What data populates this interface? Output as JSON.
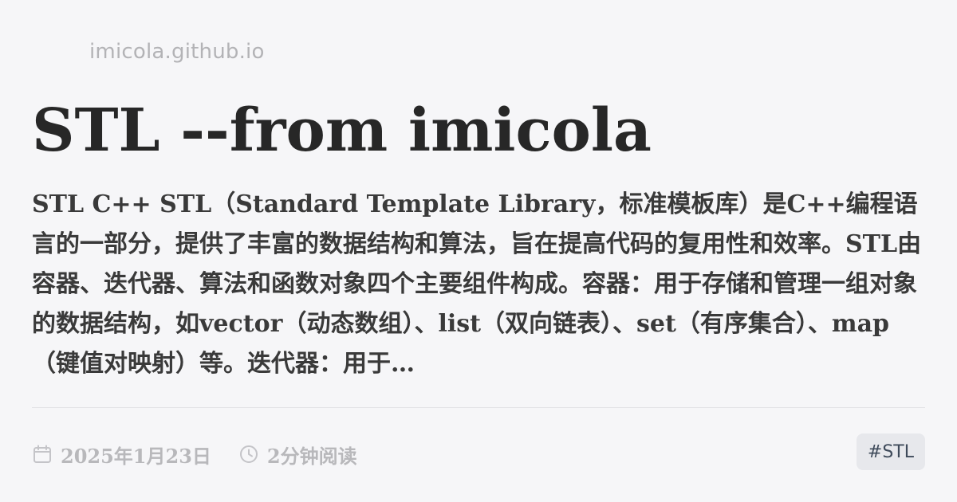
{
  "site": "imicola.github.io",
  "post": {
    "title": "STL --from imicola",
    "excerpt": "STL C++ STL（Standard Template Library，标准模板库）是C++编程语言的一部分，提供了丰富的数据结构和算法，旨在提高代码的复用性和效率。STL由容器、迭代器、算法和函数对象四个主要组件构成。容器：用于存储和管理一组对象的数据结构，如vector（动态数组）、list（双向链表）、set（有序集合）、map（键值对映射）等。迭代器：用于…",
    "date": "2025年1月23日",
    "read_time": "2分钟阅读",
    "tag": "#STL"
  },
  "icons": {
    "date": "calendar-icon",
    "read_time": "clock-icon"
  },
  "colors": {
    "background": "#f6f6f8",
    "title": "#272727",
    "muted": "#b8b8bb",
    "tag_bg": "#e7e8ec"
  }
}
